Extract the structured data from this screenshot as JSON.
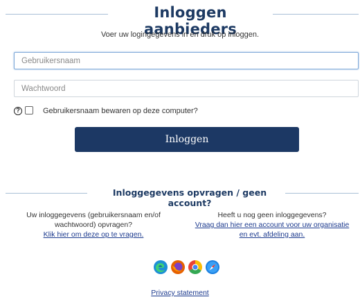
{
  "header": {
    "title": "Inloggen aanbieders",
    "subtitle": "Voer uw logingegevens in en druk op inloggen."
  },
  "form": {
    "username_placeholder": "Gebruikersnaam",
    "password_placeholder": "Wachtwoord",
    "help_icon_glyph": "?",
    "remember_label": "Gebruikersnaam bewaren op deze computer?",
    "login_button": "Inloggen"
  },
  "info": {
    "section_title": "Inloggegevens opvragen / geen account?",
    "left_text": "Uw inloggegevens (gebruikersnaam en/of wachtwoord) opvragen?",
    "left_link": "Klik hier om deze op te vragen.",
    "right_text": "Heeft u nog geen inloggegevens?",
    "right_link": "Vraag dan hier een account voor uw organisatie en evt. afdeling aan."
  },
  "browser_icons": [
    "edge-icon",
    "firefox-icon",
    "chrome-icon",
    "safari-icon"
  ],
  "footer": {
    "privacy_link": "Privacy statement"
  },
  "colors": {
    "brand_navy": "#1c3864",
    "link_blue": "#1c3a8e",
    "rule_line": "#a9bfd6"
  }
}
